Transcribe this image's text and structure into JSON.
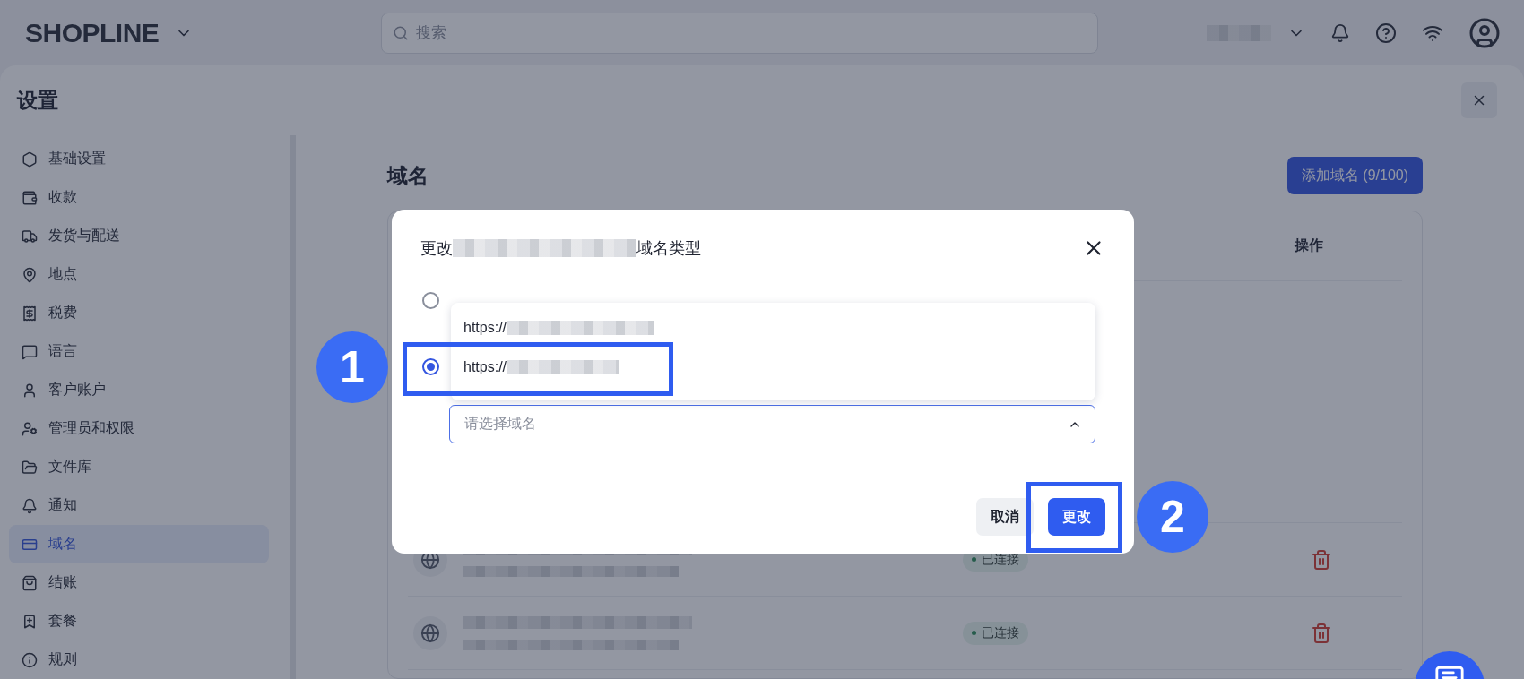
{
  "topbar": {
    "logo": "SHOPLINE",
    "search": {
      "placeholder": "搜索"
    }
  },
  "settings": {
    "title": "设置"
  },
  "sidebar": {
    "items": [
      {
        "label": "基础设置",
        "selected": false
      },
      {
        "label": "收款",
        "selected": false
      },
      {
        "label": "发货与配送",
        "selected": false
      },
      {
        "label": "地点",
        "selected": false
      },
      {
        "label": "税费",
        "selected": false
      },
      {
        "label": "语言",
        "selected": false
      },
      {
        "label": "客户账户",
        "selected": false
      },
      {
        "label": "管理员和权限",
        "selected": false
      },
      {
        "label": "文件库",
        "selected": false
      },
      {
        "label": "通知",
        "selected": false
      },
      {
        "label": "域名",
        "selected": true
      },
      {
        "label": "结账",
        "selected": false
      },
      {
        "label": "套餐",
        "selected": false
      },
      {
        "label": "规则",
        "selected": false
      }
    ]
  },
  "page": {
    "title": "域名",
    "add_button": "添加域名 (9/100)",
    "table": {
      "columns": [
        "操作"
      ],
      "rows": [
        {
          "status": "已连接"
        },
        {
          "status": "已连接"
        }
      ]
    }
  },
  "dialog": {
    "title_prefix": "更改",
    "title_suffix": "域名类型",
    "options": [
      {
        "selected": false
      },
      {
        "selected": true
      }
    ],
    "dropdown": {
      "options": [
        {
          "label": "https://"
        },
        {
          "label": "https://"
        }
      ]
    },
    "select": {
      "placeholder": "请选择域名",
      "expanded": true
    },
    "buttons": [
      {
        "label": "取消",
        "kind": "secondary"
      },
      {
        "label": "更改",
        "kind": "primary"
      }
    ]
  },
  "annotations": [
    {
      "label": "1"
    },
    {
      "label": "2"
    }
  ]
}
